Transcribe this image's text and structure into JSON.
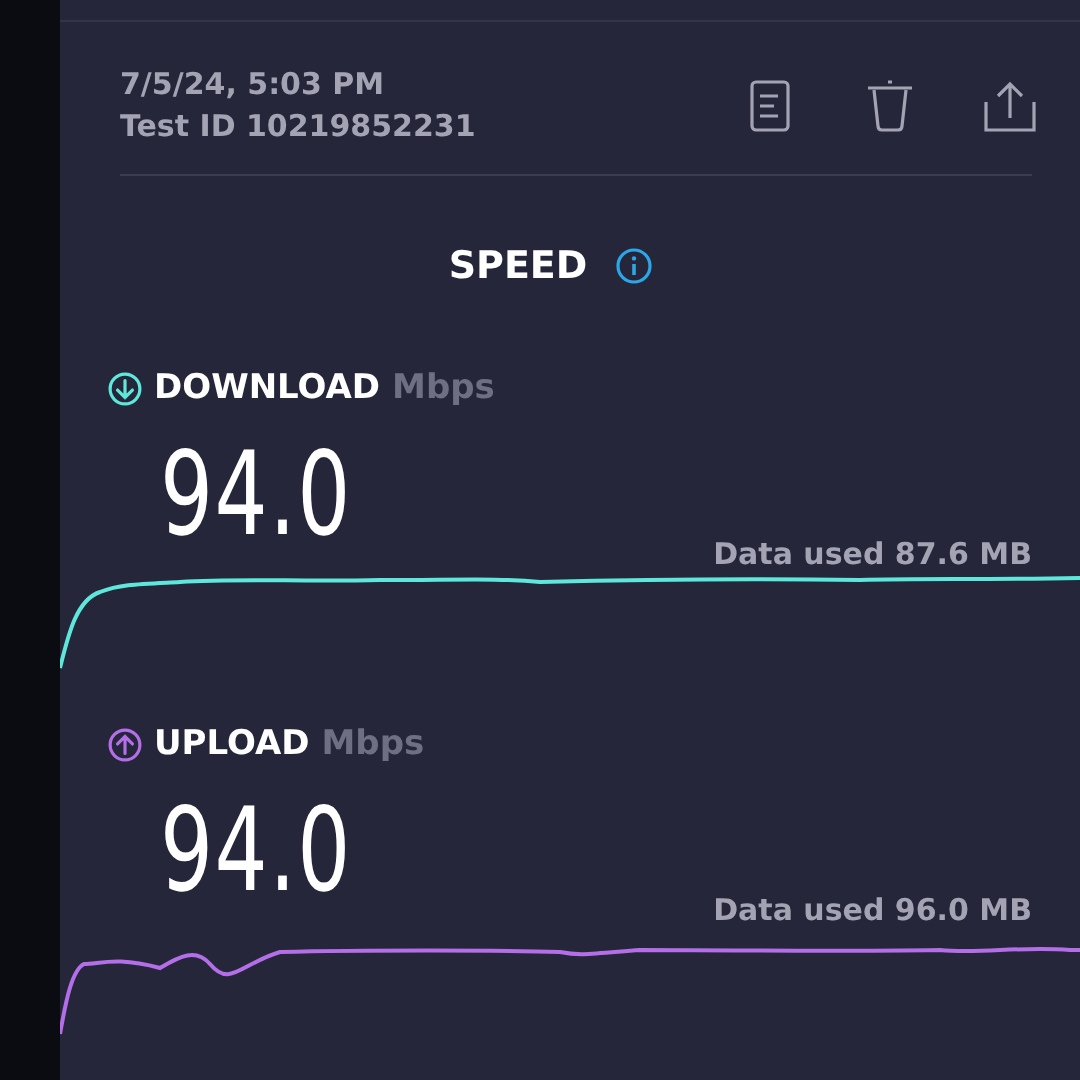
{
  "header": {
    "date": "7/5/24, 5:03 PM",
    "test_id": "Test ID 10219852231"
  },
  "title": "SPEED",
  "sections": [
    {
      "kind": "download",
      "label": "DOWNLOAD",
      "unit": "Mbps",
      "value": "94.0",
      "data_used": "Data used 87.6 MB",
      "color": "#5ee8dc"
    },
    {
      "kind": "upload",
      "label": "UPLOAD",
      "unit": "Mbps",
      "value": "94.0",
      "data_used": "Data used 96.0 MB",
      "color": "#b36ee8"
    }
  ]
}
